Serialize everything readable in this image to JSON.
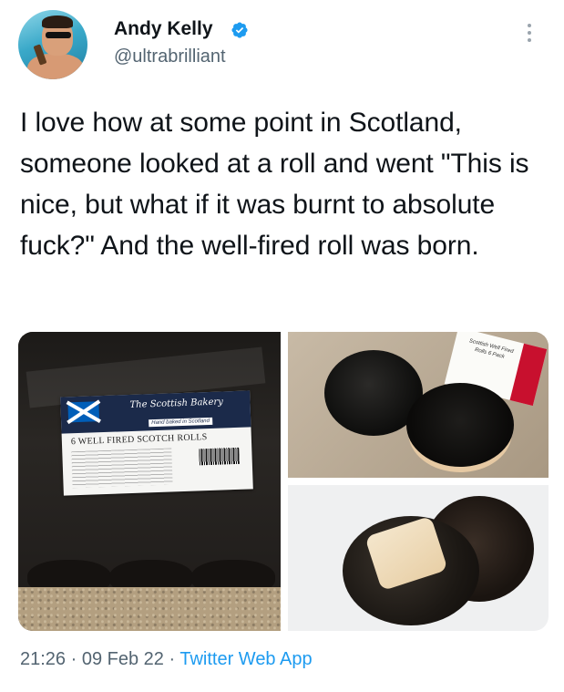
{
  "author": {
    "name": "Andy Kelly",
    "handle": "@ultrabrilliant",
    "verified_icon": "verified-badge-icon",
    "badge_color": "#1d9bf0"
  },
  "tweet": {
    "text": "I love how at some point in Scotland, someone looked at a roll and went \"This is nice, but what if it was burnt to absolute fuck?\" And the well-fired roll was born."
  },
  "media": {
    "package_label": {
      "brand": "The Scottish Bakery",
      "strapline": "Hand baked in Scotland",
      "product": "6 WELL FIRED SCOTCH ROLLS"
    },
    "sticker": {
      "text": "Scottish Well Fired Rolls 6 Pack"
    }
  },
  "footer": {
    "time": "21:26",
    "date": "09 Feb 22",
    "separator": " · ",
    "source": "Twitter Web App"
  },
  "colors": {
    "text": "#0f1419",
    "secondary": "#536471",
    "link": "#1d9bf0"
  }
}
